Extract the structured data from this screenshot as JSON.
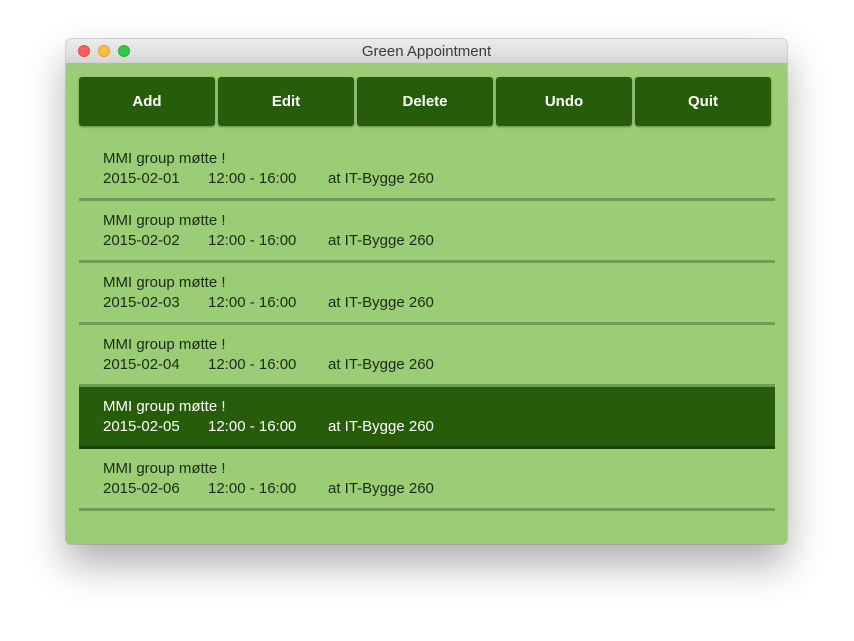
{
  "window": {
    "title": "Green Appointment"
  },
  "toolbar": {
    "buttons": [
      {
        "label": "Add",
        "active": true
      },
      {
        "label": "Edit",
        "active": false
      },
      {
        "label": "Delete",
        "active": false
      },
      {
        "label": "Undo",
        "active": false
      },
      {
        "label": "Quit",
        "active": false
      }
    ]
  },
  "appointments": [
    {
      "subject": "MMI group møtte !",
      "date": "2015-02-01",
      "time": "12:00 - 16:00",
      "place": "at IT-Bygge 260",
      "selected": false
    },
    {
      "subject": "MMI group møtte !",
      "date": "2015-02-02",
      "time": "12:00 - 16:00",
      "place": "at IT-Bygge 260",
      "selected": false
    },
    {
      "subject": "MMI group møtte !",
      "date": "2015-02-03",
      "time": "12:00 - 16:00",
      "place": "at IT-Bygge 260",
      "selected": false
    },
    {
      "subject": "MMI group møtte !",
      "date": "2015-02-04",
      "time": "12:00 - 16:00",
      "place": "at IT-Bygge 260",
      "selected": false
    },
    {
      "subject": "MMI group møtte !",
      "date": "2015-02-05",
      "time": "12:00 - 16:00",
      "place": "at IT-Bygge 260",
      "selected": true
    },
    {
      "subject": "MMI group møtte !",
      "date": "2015-02-06",
      "time": "12:00 - 16:00",
      "place": "at IT-Bygge 260",
      "selected": false
    }
  ],
  "colors": {
    "background": "#9acd75",
    "button": "#275d0a",
    "button_active": "#0b1e04",
    "selected_row": "#275d0a"
  }
}
